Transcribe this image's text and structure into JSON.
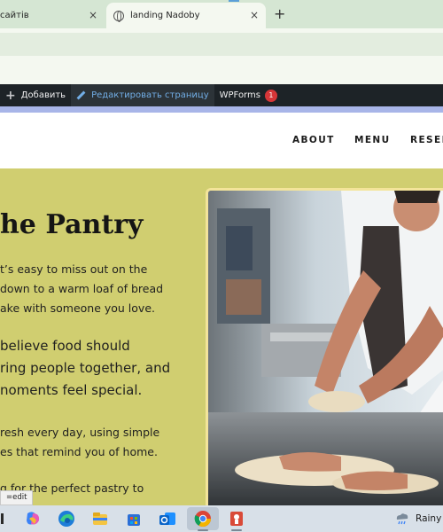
{
  "browser": {
    "tabs": [
      {
        "label": "сайтів",
        "active": false
      },
      {
        "label": "landing Nadoby",
        "active": true
      }
    ],
    "close_glyph": "×",
    "new_tab_glyph": "+"
  },
  "admin_bar": {
    "add_label": "Добавить",
    "edit_label": "Редактировать страницу",
    "wpforms_label": "WPForms",
    "wpforms_count": "1"
  },
  "nav": {
    "items": [
      "ABOUT",
      "MENU",
      "RESER"
    ]
  },
  "hero": {
    "title": "he Pantry",
    "intro_lines": [
      "t’s easy to miss out on the",
      "down to a warm loaf of bread",
      "ake with someone you love."
    ],
    "big_lines": [
      "believe food should",
      "ring people together, and",
      "noments feel special."
    ],
    "fresh_lines": [
      "resh every day, using simple",
      "es that remind you of home."
    ],
    "last_line": "g for the perfect pastry to"
  },
  "status_url": "=edit",
  "taskbar": {
    "icons": [
      "copilot-icon",
      "edge-icon",
      "file-explorer-icon",
      "store-icon",
      "outlook-icon",
      "chrome-icon",
      "app-icon"
    ],
    "weather_text": "Rainy"
  },
  "colors": {
    "hero_bg": "#d0ce70",
    "admin_bar_bg": "#1d2327",
    "tab_strip_bg": "#d5e6d3",
    "badge": "#d63638",
    "photo_border": "#f3e49a"
  }
}
